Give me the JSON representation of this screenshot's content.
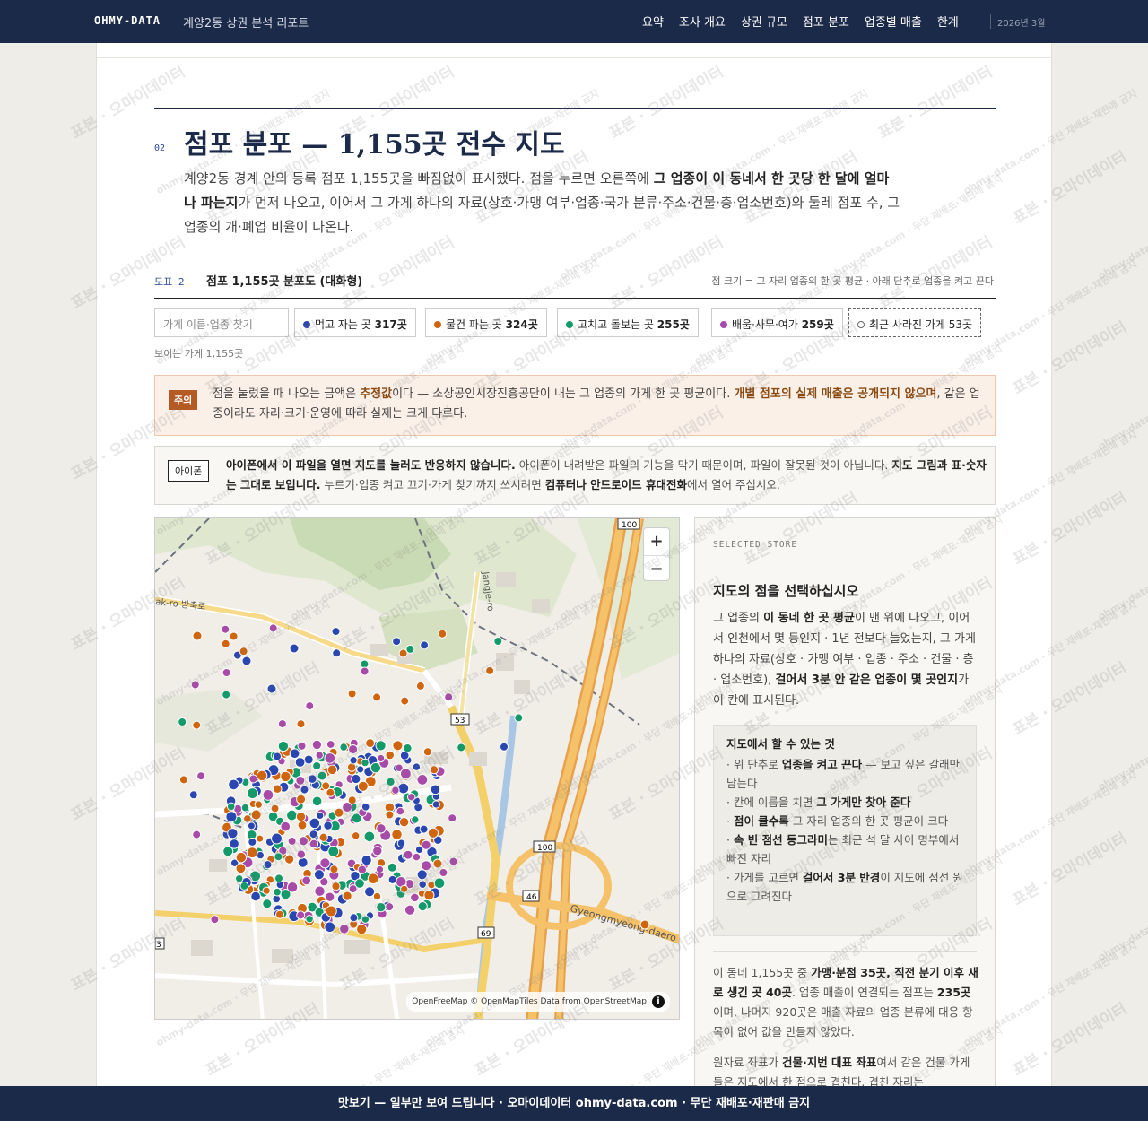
{
  "header": {
    "brand": "OHMY-DATA",
    "report_title": "계양2동 상권 분석 리포트",
    "nav": [
      "요약",
      "조사 개요",
      "상권 규모",
      "점포 분포",
      "업종별 매출",
      "한계"
    ],
    "date": "2026년 3월"
  },
  "section": {
    "number": "02",
    "title": "점포 분포 — 1,155곳 전수 지도",
    "lead_1": "계양2동 경계 안의 등록 점포 1,155곳을 빠짐없이 표시했다. 점을 누르면 오른쪽에 ",
    "lead_bold": "그 업종이 이 동네서 한 곳당 한 달에 얼마나 파는지",
    "lead_2": "가 먼저 나오고, 이어서 그 가게 하나의 자료(상호·가맹 여부·업종·국가 분류·주소·건물·층·업소번호)와 둘레 점포 수, 그 업종의 개·폐업 비율이 나온다."
  },
  "figure": {
    "label": "도표 2",
    "title": "점포 1,155곳 분포도 (대화형)",
    "note": "점 크기 = 그 자리 업종의 한 곳 평균 · 아래 단추로 업종을 켜고 끈다",
    "search_placeholder": "가게 이름·업종 찾기",
    "filters": [
      {
        "label": "먹고 자는 곳",
        "count": "317곳",
        "color": "#2a46b0"
      },
      {
        "label": "물건 파는 곳",
        "count": "324곳",
        "color": "#d0650f"
      },
      {
        "label": "고치고 돌보는 곳",
        "count": "255곳",
        "color": "#149a6a"
      },
      {
        "label": "배움·사무·여가",
        "count": "259곳",
        "color": "#a84aa8"
      },
      {
        "label": "최근 사라진 가게",
        "count": "53곳"
      }
    ],
    "visible_count": "보이는 가게 1,155곳"
  },
  "warning": {
    "badge": "주의",
    "text_1": "점을 눌렀을 때 나오는 금액은 ",
    "bold_1": "추정값",
    "text_2": "이다 — 소상공인시장진흥공단이 내는 그 업종의 가게 한 곳 평균이다. ",
    "bold_2": "개별 점포의 실제 매출은 공개되지 않으며",
    "text_3": ", 같은 업종이라도 자리·크기·운영에 따라 실제는 크게 다르다."
  },
  "iphone": {
    "badge": "아이폰",
    "bold_1": "아이폰에서 이 파일을 열면 지도를 눌러도 반응하지 않습니다.",
    "text_1": " 아이폰이 내려받은 파일의 기능을 막기 때문이며, 파일이 잘못된 것이 아닙니다. ",
    "bold_2": "지도 그림과 표·숫자는 그대로 보입니다.",
    "text_2": " 누르기·업종 켜고 끄기·가게 찾기까지 쓰시려면 ",
    "bold_3": "컴퓨터나 안드로이드 휴대전화",
    "text_3": "에서 열어 주십시오."
  },
  "map": {
    "zoom_in": "+",
    "zoom_out": "−",
    "attribution": "OpenFreeMap © OpenMapTiles Data from OpenStreetMap",
    "road_labels": [
      "100",
      "53",
      "100",
      "46",
      "69",
      "3",
      "Gyeongmyeong-daero",
      "Jangje-ro",
      "ak-ro 방축로"
    ]
  },
  "side": {
    "kicker": "SELECTED STORE",
    "title": "지도의 점을 선택하십시오",
    "p_1": "그 업종의 ",
    "p_bold_1": "이 동네 한 곳 평균",
    "p_2": "이 맨 위에 나오고, 이어서 인천에서 몇 등인지 · 1년 전보다 늘었는지, 그 가게 하나의 자료(상호 · 가맹 여부 · 업종 · 주소 · 건물 · 층 · 업소번호), ",
    "p_bold_2": "걸어서 3분 안 같은 업종이 몇 곳인지",
    "p_3": "가 이 칸에 표시된다.",
    "howto_title": "지도에서 할 수 있는 것",
    "howto": [
      {
        "pre": "· 위 단추로 ",
        "bold": "업종을 켜고 끈다",
        "post": " — 보고 싶은 갈래만 남는다"
      },
      {
        "pre": "· 칸에 이름을 치면 ",
        "bold": "그 가게만 찾아 준다",
        "post": ""
      },
      {
        "pre": "· ",
        "bold": "점이 클수록",
        "post": " 그 자리 업종의 한 곳 평균이 크다"
      },
      {
        "pre": "· ",
        "bold": "속 빈 점선 동그라미",
        "post": "는 최근 석 달 사이 명부에서 빠진 자리"
      },
      {
        "pre": "· 가게를 고르면 ",
        "bold": "걸어서 3분 반경",
        "post": "이 지도에 점선 원으로 그려진다"
      }
    ],
    "stats_1": "이 동네 1,155곳 중 ",
    "stats_bold_1": "가맹·분점 35곳, 직전 분기 이후 새로 생긴 곳 40곳",
    "stats_2": ". 업종 매출이 연결되는 점포는 ",
    "stats_bold_2": "235곳",
    "stats_3": "이며, 나머지 920곳은 매출 자료의 업종 분류에 대응 항목이 없어 값을 만들지 않았다.",
    "raw_1": "원자료 좌표가 ",
    "raw_bold": "건물·지번 대표 좌표",
    "raw_2": "여서 같은 건물 가게들은 지도에서 한 점으로 겹친다. 겹친 자리는"
  },
  "watermark": {
    "text": "표본 · 오마이데이터",
    "text_small": "ohmy-data.com · 무단 재배포·재판매 금지"
  },
  "footer": {
    "text": "맛보기 — 일부만 보여 드립니다 · 오마이데이터 ohmy-data.com · 무단 재배포·재판매 금지"
  },
  "colors": {
    "navy": "#1c2a49",
    "food": "#2a46b0",
    "retail": "#d0650f",
    "service": "#149a6a",
    "edu": "#a84aa8"
  }
}
